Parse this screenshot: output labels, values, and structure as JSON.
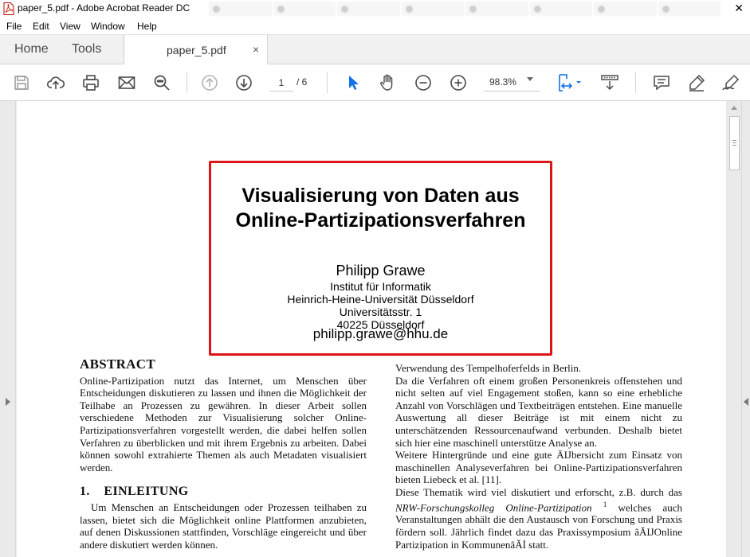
{
  "window": {
    "title": "paper_5.pdf - Adobe Acrobat Reader DC",
    "close_glyph": "✕"
  },
  "menu": [
    "File",
    "Edit",
    "View",
    "Window",
    "Help"
  ],
  "tabs": {
    "home": "Home",
    "tools": "Tools",
    "document": "paper_5.pdf",
    "close_glyph": "×"
  },
  "toolbar": {
    "page_current": "1",
    "page_total": "/ 6",
    "zoom": "98.3%",
    "icons": [
      "save-icon",
      "upload-icon",
      "print-icon",
      "email-icon",
      "find-icon",
      "page-up-icon",
      "page-down-icon",
      "select-cursor-icon",
      "hand-icon",
      "zoom-out-icon",
      "zoom-in-icon",
      "page-fit-icon",
      "scroll-mode-icon",
      "comment-icon",
      "highlight-icon",
      "sign-icon"
    ],
    "accent_color": "#1473e6"
  },
  "paper": {
    "title_line1": "Visualisierung von Daten aus",
    "title_line2": "Online-Partizipationsverfahren",
    "author": "Philipp Grawe",
    "affiliation": [
      "Institut für Informatik",
      "Heinrich-Heine-Universität Düsseldorf",
      "Universitätsstr. 1",
      "40225 Düsseldorf"
    ],
    "email": "philipp.grawe@hhu.de",
    "highlight_color": "#dd1515",
    "abstract_heading": "ABSTRACT",
    "abstract_text": "Online-Partizipation nutzt das Internet, um Menschen über Entscheidungen diskutieren zu lassen und ihnen die Möglichkeit der Teilhabe an Prozessen zu gewähren. In dieser Arbeit sollen verschiedene Methoden zur Visualisierung solcher Online-Partizipationsverfahren vorgestellt werden, die dabei helfen sollen Verfahren zu überblicken und mit ihrem Ergebnis zu arbeiten. Dabei können sowohl extrahierte Themen als auch Metadaten visualisiert werden.",
    "section1_heading": "1.    EINLEITUNG",
    "section1_text": "Um Menschen an Entscheidungen oder Prozessen teilhaben zu lassen, bietet sich die Möglichkeit online Plattformen anzubieten, auf denen Diskussionen stattfinden, Vorschläge eingereicht und über andere diskutiert werden können.",
    "right_p1": "Verwendung des Tempelhoferfelds in Berlin.",
    "right_p2": "Da die Verfahren oft einem großen Personenkreis offenstehen und nicht selten auf viel Engagement stoßen, kann so eine erhebliche Anzahl von Vorschlägen und Textbeiträgen entstehen. Eine manuelle Auswertung all dieser Beiträge ist mit einem nicht zu unterschätzenden Ressourcenaufwand verbunden. Deshalb bietet sich hier eine maschinell unterstütze Analyse an.",
    "right_p3": "Weitere Hintergründe und eine gute ÄIJbersicht zum Einsatz von maschinellen Analyseverfahren bei Online-Partizipationsverfahren bieten Liebeck et al. [11].",
    "right_p4_start": "Diese Thematik wird viel diskutiert und erforscht, z.B. durch das ",
    "right_p4_italic": "NRW-Forschungskolleg Online-Partizipation",
    "right_p4_sup": "1",
    "right_p4_end": " welches auch Veranstaltungen abhält die den Austausch von Forschung und Praxis fördern soll. Jährlich findet dazu das Praxissymposium âĂĲOnline Partizipation in KommunenâĂİ statt."
  }
}
